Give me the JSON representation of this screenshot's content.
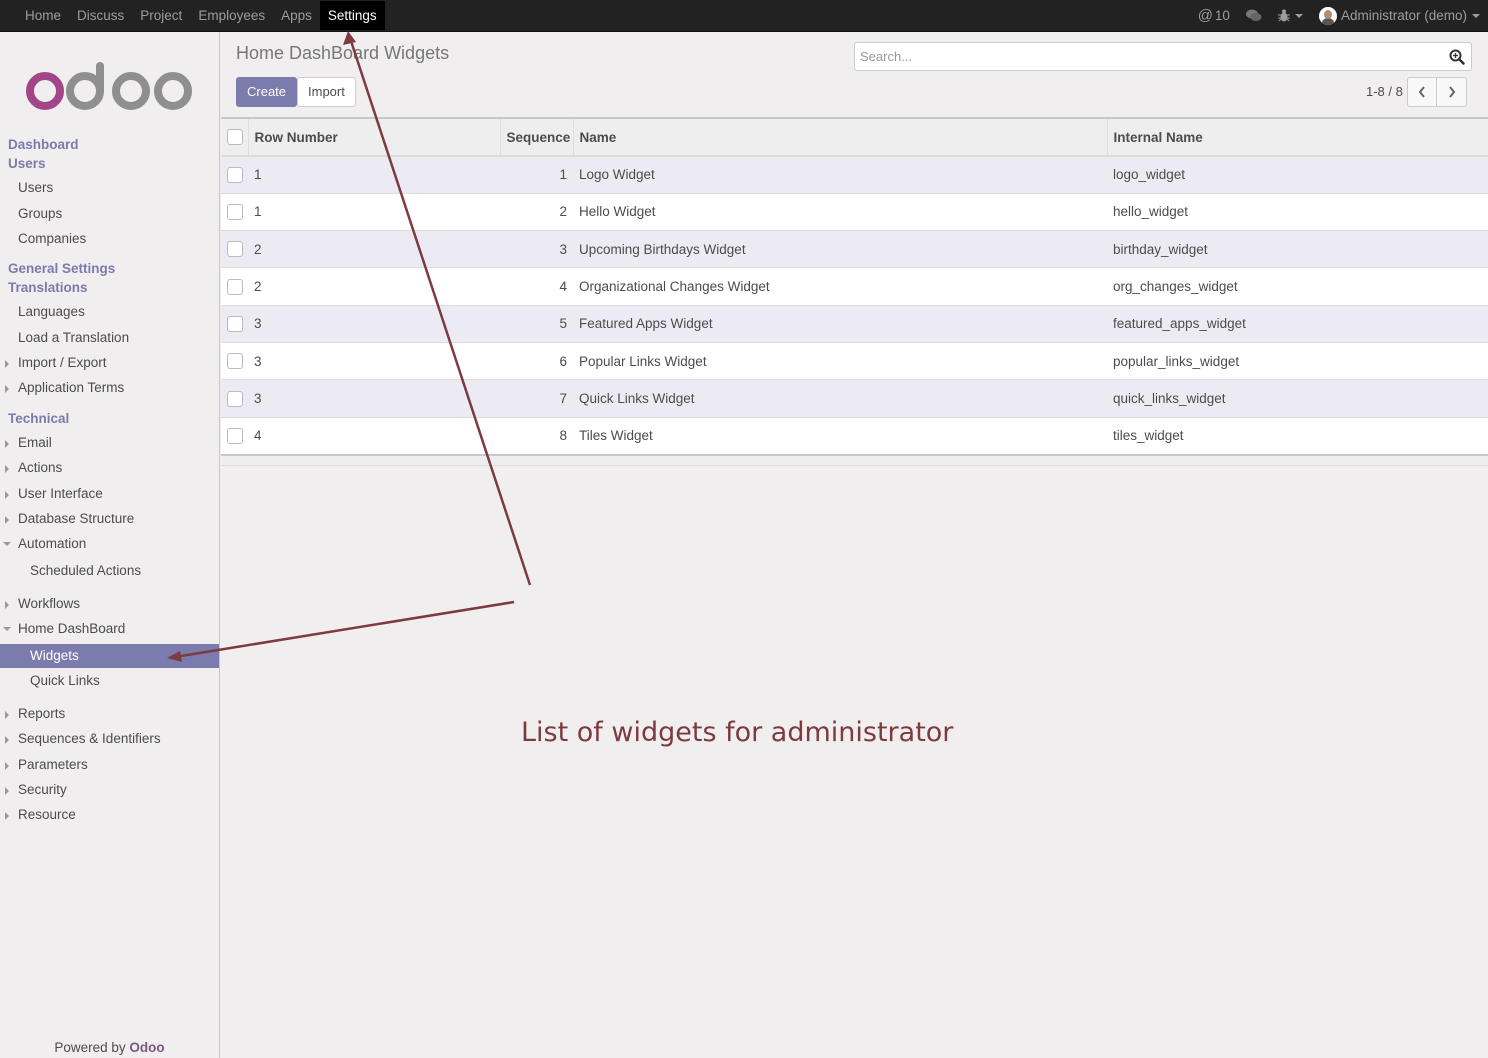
{
  "topbar": {
    "menu": [
      {
        "label": "Home",
        "active": false
      },
      {
        "label": "Discuss",
        "active": false
      },
      {
        "label": "Project",
        "active": false
      },
      {
        "label": "Employees",
        "active": false
      },
      {
        "label": "Apps",
        "active": false
      },
      {
        "label": "Settings",
        "active": true
      }
    ],
    "mentions_icon": "at-icon",
    "mentions_count": "10",
    "chat_icon": "chat-bubbles-icon",
    "debug_icon": "bug-icon",
    "user_name": "Administrator (demo)"
  },
  "sidebar": {
    "logo_text": "odoo",
    "sections": {
      "dashboard": "Dashboard",
      "users": "Users",
      "general_settings": "General Settings",
      "translations": "Translations",
      "technical": "Technical"
    },
    "items": {
      "users": "Users",
      "groups": "Groups",
      "companies": "Companies",
      "languages": "Languages",
      "load_translation": "Load a Translation",
      "import_export": "Import / Export",
      "application_terms": "Application Terms",
      "email": "Email",
      "actions": "Actions",
      "user_interface": "User Interface",
      "database_structure": "Database Structure",
      "automation": "Automation",
      "scheduled_actions": "Scheduled Actions",
      "workflows": "Workflows",
      "home_dashboard": "Home DashBoard",
      "widgets": "Widgets",
      "quick_links": "Quick Links",
      "reports": "Reports",
      "sequences": "Sequences & Identifiers",
      "parameters": "Parameters",
      "security": "Security",
      "resource": "Resource"
    },
    "powered_by": "Powered by",
    "powered_brand": "Odoo"
  },
  "control_panel": {
    "title": "Home DashBoard Widgets",
    "create_label": "Create",
    "import_label": "Import",
    "search_placeholder": "Search...",
    "search_value": "",
    "pager": "1-8 / 8"
  },
  "table": {
    "headers": {
      "row_number": "Row Number",
      "sequence": "Sequence",
      "name": "Name",
      "internal_name": "Internal Name"
    },
    "rows": [
      {
        "row_number": "1",
        "sequence": "1",
        "name": "Logo Widget",
        "internal_name": "logo_widget"
      },
      {
        "row_number": "1",
        "sequence": "2",
        "name": "Hello Widget",
        "internal_name": "hello_widget"
      },
      {
        "row_number": "2",
        "sequence": "3",
        "name": "Upcoming Birthdays Widget",
        "internal_name": "birthday_widget"
      },
      {
        "row_number": "2",
        "sequence": "4",
        "name": "Organizational Changes Widget",
        "internal_name": "org_changes_widget"
      },
      {
        "row_number": "3",
        "sequence": "5",
        "name": "Featured Apps Widget",
        "internal_name": "featured_apps_widget"
      },
      {
        "row_number": "3",
        "sequence": "6",
        "name": "Popular Links Widget",
        "internal_name": "popular_links_widget"
      },
      {
        "row_number": "3",
        "sequence": "7",
        "name": "Quick Links Widget",
        "internal_name": "quick_links_widget"
      },
      {
        "row_number": "4",
        "sequence": "8",
        "name": "Tiles Widget",
        "internal_name": "tiles_widget"
      }
    ]
  },
  "annotation": {
    "text": "List of widgets for administrator",
    "color": "#7d3b40"
  },
  "colors": {
    "brand_purple": "#7c7bad",
    "logo_o": "#a24689",
    "logo_doo": "#8f8f8f"
  }
}
